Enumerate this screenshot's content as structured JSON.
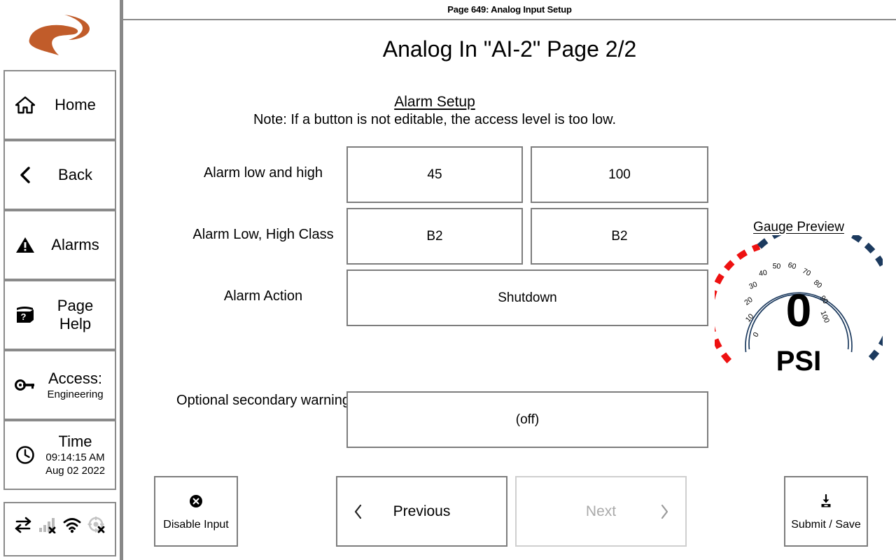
{
  "header": {
    "title": "Page 649: Analog Input Setup"
  },
  "page": {
    "title": "Analog In \"AI-2\" Page 2/2",
    "section_title": "Alarm Setup",
    "section_note": "Note: If a button is not editable, the access level is too low."
  },
  "sidebar": {
    "logo_name": "swoosh-logo",
    "logo_color": "#c15c2a",
    "items": [
      {
        "label": "Home",
        "icon": "home-icon"
      },
      {
        "label": "Back",
        "icon": "chevron-left-icon"
      },
      {
        "label": "Alarms",
        "icon": "warning-triangle-icon"
      },
      {
        "label": "Page",
        "label2": "Help",
        "icon": "help-book-icon"
      },
      {
        "label": "Access:",
        "sub": "Engineering",
        "icon": "key-icon"
      },
      {
        "label": "Time",
        "sub": "09:14:15 AM",
        "sub2": "Aug 02 2022",
        "icon": "clock-icon"
      }
    ],
    "status_icons": [
      {
        "name": "network-exchange-icon",
        "state": "active"
      },
      {
        "name": "cellular-signal-off-icon",
        "state": "disabled"
      },
      {
        "name": "wifi-icon",
        "state": "active"
      },
      {
        "name": "gps-off-icon",
        "state": "disabled"
      }
    ]
  },
  "form": {
    "rows": [
      {
        "label": "Alarm low and high",
        "fields": [
          {
            "value": "45",
            "name": "alarm-low-value-button"
          },
          {
            "value": "100",
            "name": "alarm-high-value-button"
          }
        ]
      },
      {
        "label": "Alarm Low, High Class",
        "fields": [
          {
            "value": "B2",
            "name": "alarm-low-class-button"
          },
          {
            "value": "B2",
            "name": "alarm-high-class-button"
          }
        ]
      },
      {
        "label": "Alarm Action",
        "fields": [
          {
            "value": "Shutdown",
            "name": "alarm-action-button"
          }
        ]
      },
      {
        "label": "Optional secondary warning",
        "fields": [
          {
            "value": "(off)",
            "name": "secondary-warning-button"
          }
        ]
      }
    ]
  },
  "gauge": {
    "title": "Gauge Preview",
    "value": "0",
    "units": "PSI",
    "min": 0,
    "max": 100,
    "tick_labels": [
      "0",
      "10",
      "20",
      "30",
      "40",
      "50",
      "60",
      "70",
      "80",
      "90",
      "100"
    ],
    "ring_color": "#1c3a5e",
    "low_band_color": "#ee1111",
    "high_band_color": "#1c3a5e"
  },
  "actions": {
    "disable_input": {
      "label": "Disable Input",
      "icon": "cancel-circle-icon"
    },
    "previous": {
      "label": "Previous",
      "icon": "chevron-left-icon",
      "disabled": false
    },
    "next": {
      "label": "Next",
      "icon": "chevron-right-icon",
      "disabled": true
    },
    "submit": {
      "label": "Submit / Save",
      "icon": "download-save-icon"
    }
  }
}
